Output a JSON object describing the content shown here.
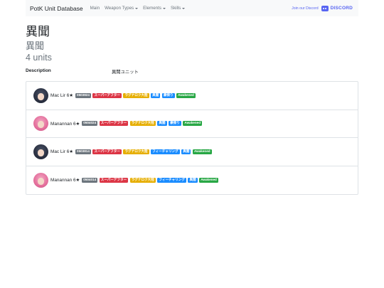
{
  "navbar": {
    "brand": "PotK Unit Database",
    "links": [
      {
        "label": "Main",
        "dropdown": false
      },
      {
        "label": "Weapon Types",
        "dropdown": true
      },
      {
        "label": "Elements",
        "dropdown": true
      },
      {
        "label": "Skills",
        "dropdown": true
      }
    ],
    "join_text": "Join our Discord",
    "discord_label": "DISCORD"
  },
  "page": {
    "title": "異聞",
    "subtitle": "異聞",
    "count_text": "4 units",
    "description_label": "Description",
    "description_value": "異聞ユニット"
  },
  "colors": {
    "gray": "#6c757d",
    "red": "#dc3545",
    "yellow": "#e6ae00",
    "blue": "#1a8cff",
    "green": "#28a745",
    "discord": "#5865f2"
  },
  "units": [
    {
      "name": "Mac Lir 6★",
      "avatar": "dark",
      "badges": [
        {
          "text": "0503824",
          "color": "gray"
        },
        {
          "text": "スーパーアフター",
          "color": "red"
        },
        {
          "text": "ラグナロク大陸",
          "color": "yellow"
        },
        {
          "text": "異聞",
          "color": "blue"
        },
        {
          "text": "豪傑り",
          "color": "blue"
        },
        {
          "text": "Awakened",
          "color": "green"
        }
      ]
    },
    {
      "name": "Manannan 6★",
      "avatar": "pink",
      "badges": [
        {
          "text": "0504024",
          "color": "gray"
        },
        {
          "text": "スーパーアフター",
          "color": "red"
        },
        {
          "text": "ラグナロク大陸",
          "color": "yellow"
        },
        {
          "text": "異聞",
          "color": "blue"
        },
        {
          "text": "豪傑り",
          "color": "blue"
        },
        {
          "text": "Awakened",
          "color": "green"
        }
      ]
    },
    {
      "name": "Mac Lir 6★",
      "avatar": "dark",
      "badges": [
        {
          "text": "0503814",
          "color": "gray"
        },
        {
          "text": "スーパーアフター",
          "color": "red"
        },
        {
          "text": "ラグナロク大陸",
          "color": "yellow"
        },
        {
          "text": "フィーチャリング",
          "color": "blue"
        },
        {
          "text": "異聞",
          "color": "blue"
        },
        {
          "text": "Awakened",
          "color": "green"
        }
      ]
    },
    {
      "name": "Manannan 6★",
      "avatar": "pink",
      "badges": [
        {
          "text": "0504014",
          "color": "gray"
        },
        {
          "text": "スーパーアフター",
          "color": "red"
        },
        {
          "text": "ラグナロク大陸",
          "color": "yellow"
        },
        {
          "text": "フィーチャリング",
          "color": "blue"
        },
        {
          "text": "異聞",
          "color": "blue"
        },
        {
          "text": "Awakened",
          "color": "green"
        }
      ]
    }
  ]
}
